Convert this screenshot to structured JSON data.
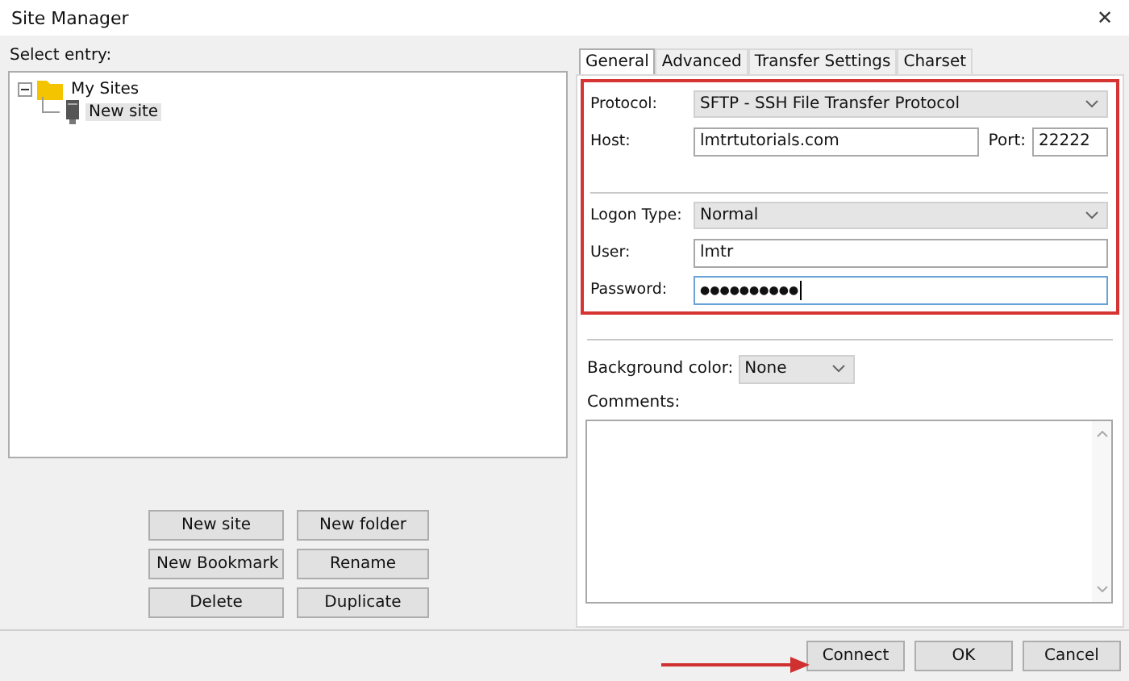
{
  "window": {
    "title": "Site Manager",
    "close": "✕"
  },
  "entry_label": "Select entry:",
  "tree": [
    {
      "label": "My Sites",
      "kind": "folder",
      "expanded": true,
      "selected": false,
      "children": [
        {
          "label": "New site",
          "kind": "site",
          "selected": true
        }
      ]
    }
  ],
  "tree_buttons": [
    "New site",
    "New folder",
    "New Bookmark",
    "Rename",
    "Delete",
    "Duplicate"
  ],
  "tabs": [
    {
      "label": "General",
      "selected": true
    },
    {
      "label": "Advanced",
      "selected": false
    },
    {
      "label": "Transfer Settings",
      "selected": false
    },
    {
      "label": "Charset",
      "selected": false
    }
  ],
  "protocol": {
    "label": "Protocol:",
    "value": "SFTP - SSH File Transfer Protocol"
  },
  "host": {
    "label": "Host:",
    "value": "lmtrtutorials.com"
  },
  "port": {
    "label": "Port:",
    "value": "22222"
  },
  "logon_type": {
    "label": "Logon Type:",
    "value": "Normal"
  },
  "user": {
    "label": "User:",
    "value": "lmtr"
  },
  "password": {
    "label": "Password:",
    "value": "●●●●●●●●●●"
  },
  "background_color": {
    "label": "Background color:",
    "value": "None"
  },
  "comments": {
    "label": "Comments:"
  },
  "buttons": [
    "Connect",
    "OK",
    "Cancel"
  ]
}
